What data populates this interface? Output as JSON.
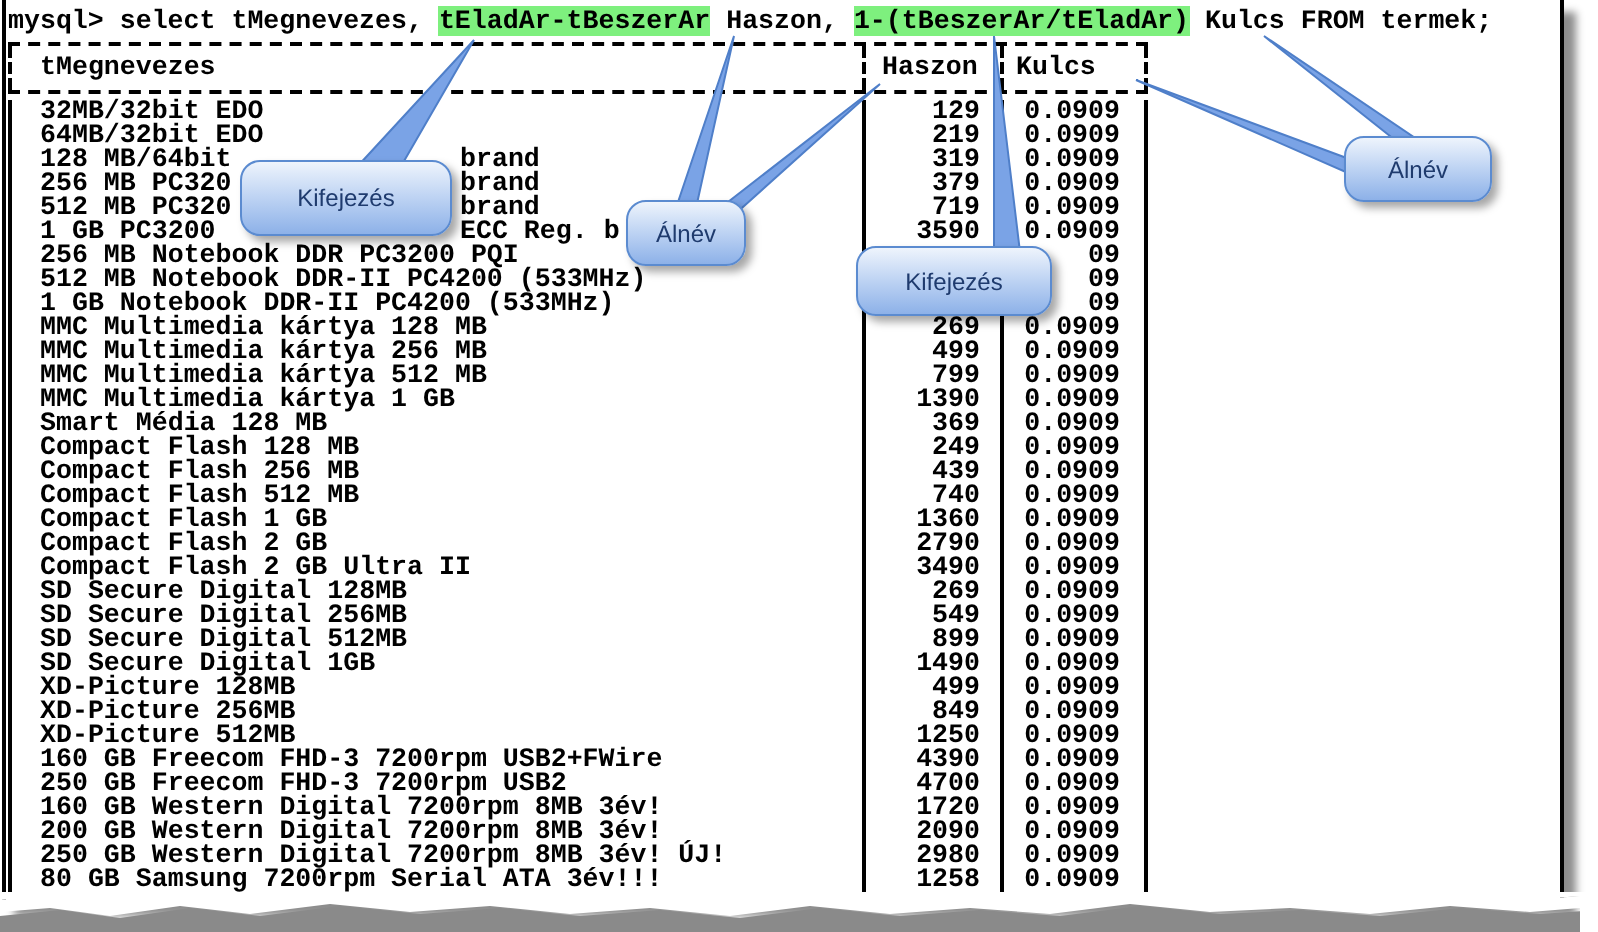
{
  "command": [
    {
      "text": "mysql> select tMegnevezes, ",
      "highlighted": false
    },
    {
      "text": "tEladAr-tBeszerAr",
      "highlighted": true
    },
    {
      "text": " Haszon, ",
      "highlighted": false
    },
    {
      "text": "1-(tBeszerAr/tEladAr)",
      "highlighted": true
    },
    {
      "text": " Kulcs FROM termek;",
      "highlighted": false
    }
  ],
  "table": {
    "columns": [
      "tMegnevezes",
      "Haszon",
      "Kulcs"
    ],
    "rows": [
      {
        "name": [
          "32MB/32bit EDO"
        ],
        "haszon": "129",
        "kulcs": "0.0909"
      },
      {
        "name": [
          "64MB/32bit EDO"
        ],
        "haszon": "219",
        "kulcs": "0.0909"
      },
      {
        "name": [
          "128 MB/64bit",
          "brand"
        ],
        "haszon": "319",
        "kulcs": "0.0909"
      },
      {
        "name": [
          "256 MB PC320",
          "brand"
        ],
        "haszon": "379",
        "kulcs": "0.0909"
      },
      {
        "name": [
          "512 MB PC320",
          "brand"
        ],
        "haszon": "719",
        "kulcs": "0.0909"
      },
      {
        "name": [
          "1 GB PC3200",
          "ECC Reg. b"
        ],
        "haszon": "3590",
        "kulcs": "0.0909"
      },
      {
        "name": [
          "256 MB Notebook DDR PC3200 PQI"
        ],
        "kulcs": "09"
      },
      {
        "name": [
          "512 MB Notebook DDR-II PC4200 (533MHz)"
        ],
        "kulcs": "09"
      },
      {
        "name": [
          "1 GB Notebook DDR-II PC4200 (533MHz)"
        ],
        "kulcs": "09"
      },
      {
        "name": [
          "MMC Multimedia kártya 128 MB"
        ],
        "haszon": "269",
        "kulcs": "0.0909"
      },
      {
        "name": [
          "MMC Multimedia kártya 256 MB"
        ],
        "haszon": "499",
        "kulcs": "0.0909"
      },
      {
        "name": [
          "MMC Multimedia kártya 512 MB"
        ],
        "haszon": "799",
        "kulcs": "0.0909"
      },
      {
        "name": [
          "MMC Multimedia kártya 1 GB"
        ],
        "haszon": "1390",
        "kulcs": "0.0909"
      },
      {
        "name": [
          "Smart Média 128 MB"
        ],
        "haszon": "369",
        "kulcs": "0.0909"
      },
      {
        "name": [
          "Compact Flash 128 MB"
        ],
        "haszon": "249",
        "kulcs": "0.0909"
      },
      {
        "name": [
          "Compact Flash 256 MB"
        ],
        "haszon": "439",
        "kulcs": "0.0909"
      },
      {
        "name": [
          "Compact Flash 512 MB"
        ],
        "haszon": "740",
        "kulcs": "0.0909"
      },
      {
        "name": [
          "Compact Flash 1 GB"
        ],
        "haszon": "1360",
        "kulcs": "0.0909"
      },
      {
        "name": [
          "Compact Flash 2 GB"
        ],
        "haszon": "2790",
        "kulcs": "0.0909"
      },
      {
        "name": [
          "Compact Flash 2 GB Ultra II"
        ],
        "haszon": "3490",
        "kulcs": "0.0909"
      },
      {
        "name": [
          "SD Secure Digital 128MB"
        ],
        "haszon": "269",
        "kulcs": "0.0909"
      },
      {
        "name": [
          "SD Secure Digital 256MB"
        ],
        "haszon": "549",
        "kulcs": "0.0909"
      },
      {
        "name": [
          "SD Secure Digital 512MB"
        ],
        "haszon": "899",
        "kulcs": "0.0909"
      },
      {
        "name": [
          "SD Secure Digital 1GB"
        ],
        "haszon": "1490",
        "kulcs": "0.0909"
      },
      {
        "name": [
          "XD-Picture 128MB"
        ],
        "haszon": "499",
        "kulcs": "0.0909"
      },
      {
        "name": [
          "XD-Picture 256MB"
        ],
        "haszon": "849",
        "kulcs": "0.0909"
      },
      {
        "name": [
          "XD-Picture 512MB"
        ],
        "haszon": "1250",
        "kulcs": "0.0909"
      },
      {
        "name": [
          "160 GB Freecom FHD-3 7200rpm USB2+FWire"
        ],
        "haszon": "4390",
        "kulcs": "0.0909"
      },
      {
        "name": [
          "250 GB Freecom FHD-3 7200rpm USB2"
        ],
        "haszon": "4700",
        "kulcs": "0.0909"
      },
      {
        "name": [
          "160 GB Western Digital 7200rpm 8MB 3év!"
        ],
        "haszon": "1720",
        "kulcs": "0.0909"
      },
      {
        "name": [
          "200 GB Western Digital 7200rpm 8MB 3év!"
        ],
        "haszon": "2090",
        "kulcs": "0.0909"
      },
      {
        "name": [
          "250 GB Western Digital 7200rpm 8MB 3év! ÚJ!"
        ],
        "haszon": "2980",
        "kulcs": "0.0909"
      },
      {
        "name": [
          "80 GB Samsung 7200rpm Serial ATA 3év!!!"
        ],
        "haszon": "1258",
        "kulcs": "0.0909"
      }
    ]
  },
  "callouts": [
    {
      "text": "Kifejezés"
    },
    {
      "text": "Álnév"
    },
    {
      "text": "Kifejezés"
    },
    {
      "text": "Álnév"
    }
  ]
}
